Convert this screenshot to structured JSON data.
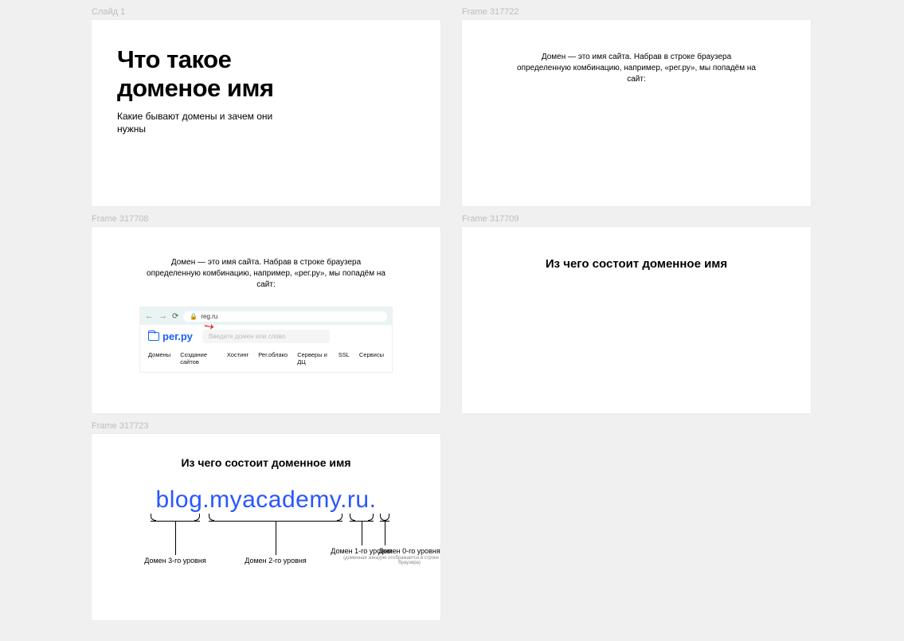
{
  "frames": {
    "f1": {
      "label": "Слайд 1"
    },
    "f2": {
      "label": "Frame 317722"
    },
    "f3": {
      "label": "Frame 317708"
    },
    "f4": {
      "label": "Frame 317709"
    },
    "f5": {
      "label": "Frame 317723"
    }
  },
  "slide1": {
    "title_line1": "Что такое",
    "title_line2": "доменое имя",
    "subtitle": "Какие бывают домены и зачем они нужны"
  },
  "slide2": {
    "text": "Домен — это имя сайта. Набрав в строке браузера определенную комбинацию, например, «рег.ру», мы попадём на сайт:"
  },
  "slide3": {
    "text": "Домен — это имя сайта. Набрав в строке браузера определенную комбинацию, например, «рег.ру», мы попадём на сайт:",
    "address": "reg.ru",
    "logo": "рег.ру",
    "search_placeholder": "Введите домен или слово",
    "menu": [
      "Домены",
      "Создание сайтов",
      "Хостинг",
      "Рег.облако",
      "Серверы и ДЦ",
      "SSL",
      "Сервисы"
    ]
  },
  "slide4": {
    "title": "Из чего состоит доменное имя"
  },
  "slide5": {
    "title": "Из чего состоит доменное имя",
    "domain": "blog.myacademy.ru.",
    "levels": {
      "l3": "Домен 3-го уровня",
      "l2": "Домен 2-го уровня",
      "l1": "Домен 1-го уровня",
      "l1_sub": "(доменная зона)",
      "l0": "Домен 0-го уровня",
      "l0_sub": "(не отображается в строке браузера)"
    }
  }
}
